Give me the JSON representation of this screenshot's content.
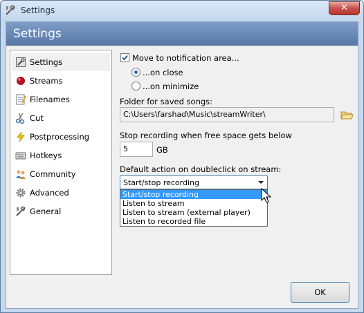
{
  "window": {
    "title": "Settings",
    "close_glyph": "✕"
  },
  "header": {
    "title": "Settings"
  },
  "sidebar": {
    "items": [
      {
        "label": "Settings",
        "icon": "settings-icon"
      },
      {
        "label": "Streams",
        "icon": "red-dot-icon"
      },
      {
        "label": "Filenames",
        "icon": "document-icon"
      },
      {
        "label": "Cut",
        "icon": "scissors-icon"
      },
      {
        "label": "Postprocessing",
        "icon": "lightning-icon"
      },
      {
        "label": "Hotkeys",
        "icon": "keyboard-icon"
      },
      {
        "label": "Community",
        "icon": "people-icon"
      },
      {
        "label": "Advanced",
        "icon": "gear-icon"
      },
      {
        "label": "General",
        "icon": "tools-icon"
      }
    ],
    "selected": "Settings"
  },
  "settings": {
    "tray_checkbox_label": "Move to notification area...",
    "tray_checked": true,
    "on_close_label": "...on close",
    "on_minimize_label": "...on minimize",
    "selected_radio": "on_close",
    "folder_label": "Folder for saved songs:",
    "folder_value": "C:\\Users\\farshad\\Music\\streamWriter\\",
    "free_space_label": "Stop recording when free space gets below",
    "free_space_value": "5",
    "free_space_unit": "GB",
    "doubleclick_label": "Default action on doubleclick on stream:",
    "doubleclick_selected": "Start/stop recording",
    "doubleclick_options": [
      "Start/stop recording",
      "Listen to stream",
      "Listen to stream (external player)",
      "Listen to recorded file"
    ]
  },
  "footer": {
    "ok_label": "OK"
  },
  "colors": {
    "header_band": "#6a8ab8",
    "highlight": "#3399ff",
    "focus_border": "#3c7fb1"
  }
}
